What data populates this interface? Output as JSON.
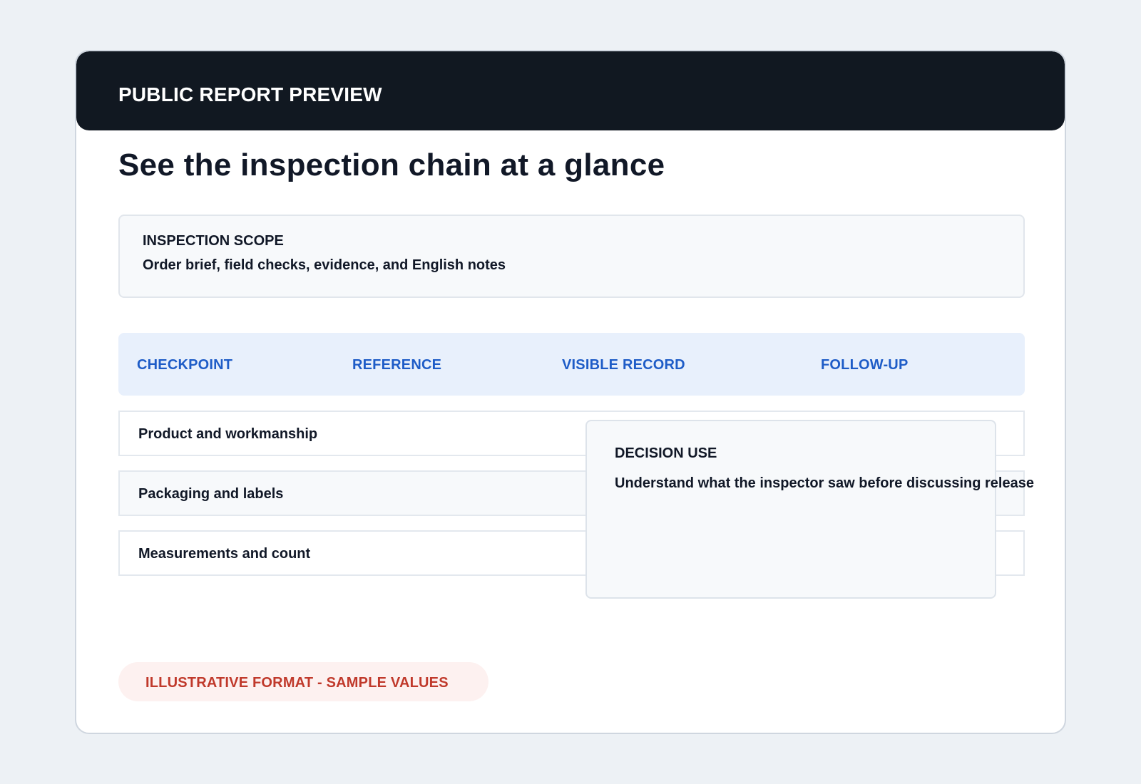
{
  "header": {
    "title": "PUBLIC REPORT PREVIEW"
  },
  "page": {
    "title": "See the inspection chain at a glance"
  },
  "scope": {
    "label": "INSPECTION SCOPE",
    "value": "Order brief, field checks, evidence, and English notes"
  },
  "table": {
    "columns": [
      "CHECKPOINT",
      "REFERENCE",
      "VISIBLE RECORD",
      "FOLLOW-UP"
    ],
    "rows": [
      {
        "checkpoint": "Product and workmanship"
      },
      {
        "checkpoint": "Packaging and labels"
      },
      {
        "checkpoint": "Measurements and count"
      }
    ]
  },
  "decision": {
    "label": "DECISION USE",
    "value": "Understand what the inspector saw before discussing release"
  },
  "badge": {
    "label": "ILLUSTRATIVE FORMAT - SAMPLE VALUES"
  },
  "colors": {
    "page_background": "#edf1f5",
    "header_background": "#111821",
    "column_header_text": "#1e5cc7",
    "column_header_background": "#e8f0fc",
    "badge_text": "#c0392b",
    "badge_background": "#fdf1f0"
  }
}
